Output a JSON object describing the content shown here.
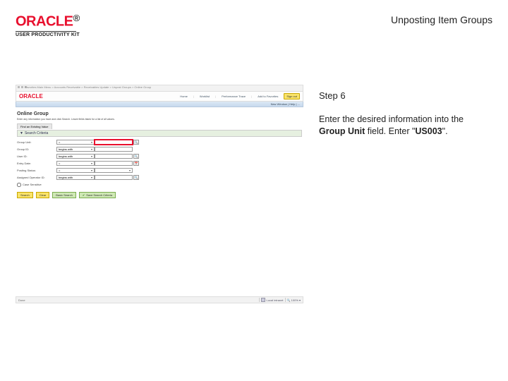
{
  "header": {
    "logo": "ORACLE",
    "logo_mark": "®",
    "sub": "USER PRODUCTIVITY KIT",
    "title": "Unposting Item Groups"
  },
  "app": {
    "topbar_text": "Favorites   Main Menu > Accounts Receivable > Receivables Update > Unpost Groups > Online Group",
    "brand": "ORACLE",
    "nav": [
      "Home",
      "Worklist",
      "Performance Trace",
      "Add to Favorites"
    ],
    "signout_dd": "",
    "signout": "Sign out",
    "bluebar_right": "New Window | Help | ..."
  },
  "page": {
    "title": "Online Group",
    "sub": "Enter any information you have and click Search. Leave fields blank for a list of all values."
  },
  "tabs": {
    "active": "Find an Existing Value"
  },
  "collapsible": {
    "label": "Search Criteria",
    "tri": "▼"
  },
  "form": {
    "rows": [
      {
        "label": "Group Unit:",
        "value": "",
        "op": "="
      },
      {
        "label": "Group ID:",
        "value": "begins with",
        "op": ""
      },
      {
        "label": "User ID:",
        "value": "begins with",
        "op": ""
      },
      {
        "label": "Entry Date:",
        "value": "",
        "op": "="
      },
      {
        "label": "Posting Status:",
        "value": "",
        "op": "="
      },
      {
        "label": "Assigned Operator ID:",
        "value": "begins with",
        "op": ""
      }
    ],
    "case_label": "Case Sensitive"
  },
  "buttons": {
    "search": "Search",
    "clear": "Clear",
    "basic": "Basic Search",
    "save": "Save Search Criteria"
  },
  "tray": {
    "left": "Done",
    "internet": "Local intranet",
    "zoom": "100%"
  },
  "instructions": {
    "step": "Step 6",
    "line1": "Enter the desired information into the ",
    "bold1": "Group Unit",
    "mid1": " field. Enter \"",
    "bold2": "US003",
    "end": "\"."
  }
}
